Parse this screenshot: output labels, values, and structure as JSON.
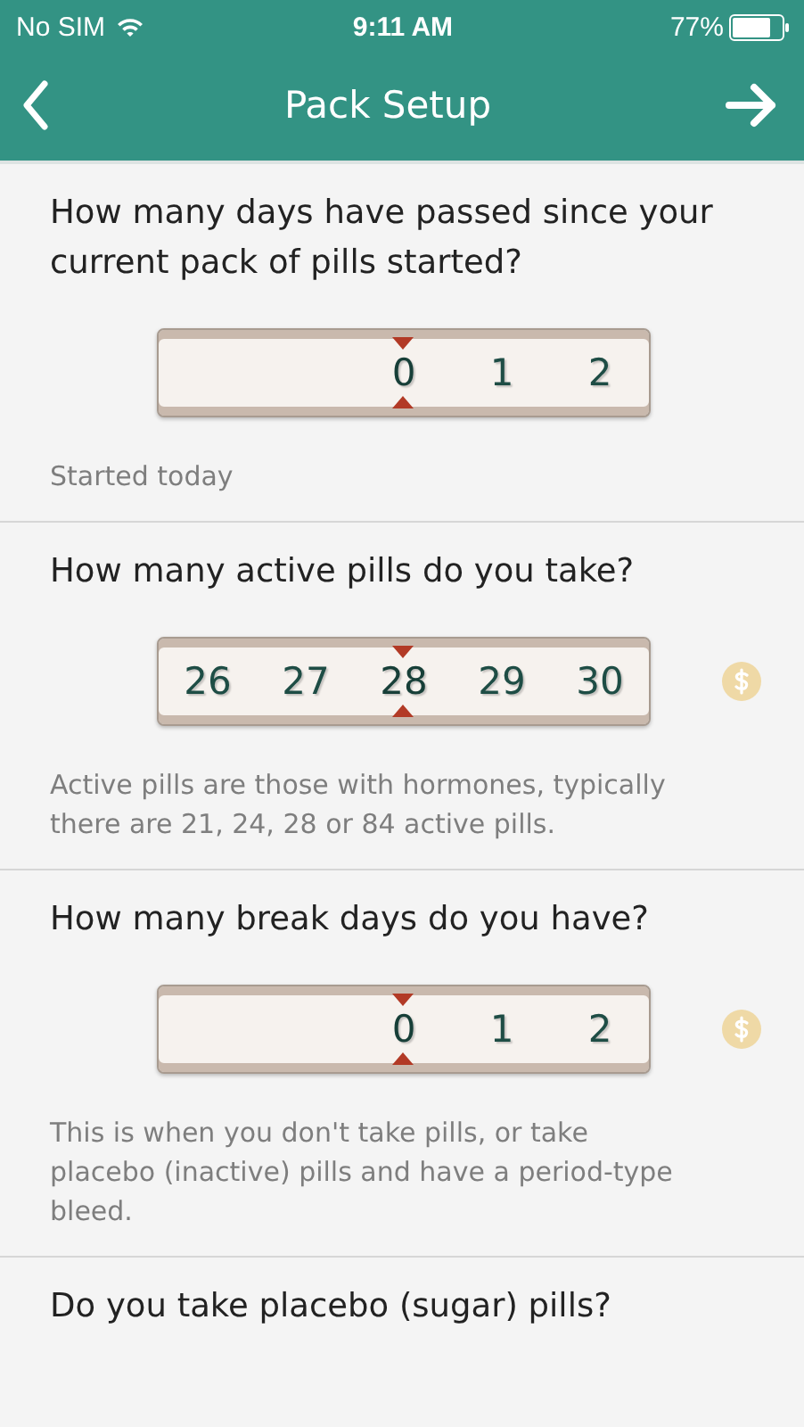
{
  "status_bar": {
    "carrier": "No SIM",
    "time": "9:11 AM",
    "battery": "77%"
  },
  "nav": {
    "title": "Pack Setup"
  },
  "sections": [
    {
      "question": "How many days have passed since your current pack of pills started?",
      "picker": {
        "values": [
          {
            "label": "0",
            "selected": true
          },
          {
            "label": "1",
            "selected": false
          },
          {
            "label": "2",
            "selected": false
          }
        ]
      },
      "premium": false,
      "note": "Started today"
    },
    {
      "question": "How many active pills do you take?",
      "picker": {
        "values": [
          {
            "label": "26",
            "selected": false
          },
          {
            "label": "27",
            "selected": false
          },
          {
            "label": "28",
            "selected": true
          },
          {
            "label": "29",
            "selected": false
          },
          {
            "label": "30",
            "selected": false
          }
        ]
      },
      "premium": true,
      "note": "Active pills are those with hormones, typically there are 21, 24, 28 or 84 active pills."
    },
    {
      "question": "How many break days do you have?",
      "picker": {
        "values": [
          {
            "label": "0",
            "selected": true
          },
          {
            "label": "1",
            "selected": false
          },
          {
            "label": "2",
            "selected": false
          }
        ]
      },
      "premium": true,
      "note": "This is when you don't take pills, or take placebo (inactive) pills and have a period-type bleed."
    },
    {
      "question": "Do you take placebo (sugar) pills?"
    }
  ]
}
